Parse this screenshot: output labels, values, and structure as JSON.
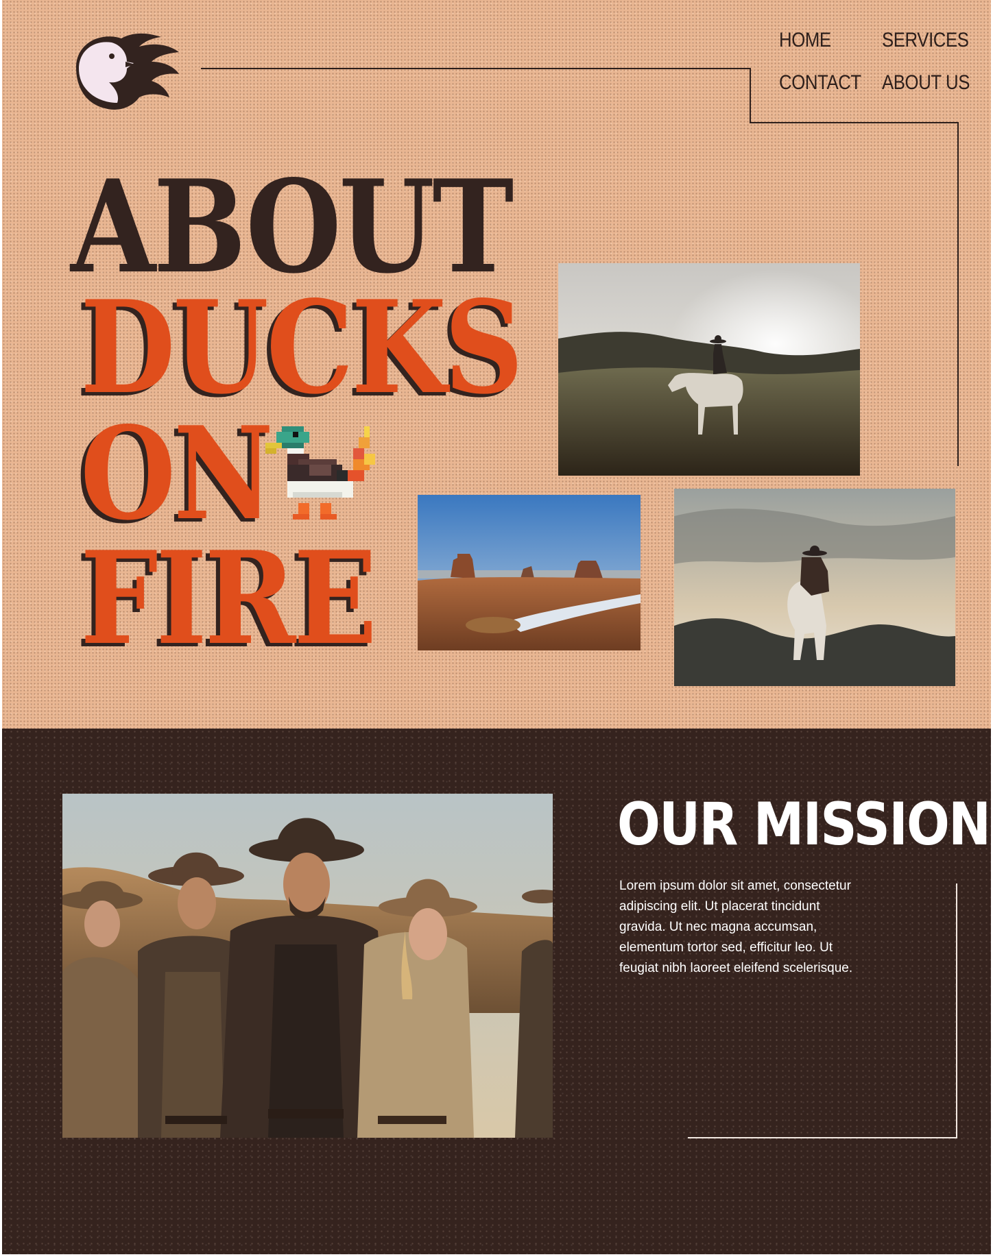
{
  "nav": {
    "home": "HOME",
    "services": "SERVICES",
    "contact": "CONTACT",
    "about": "ABOUT US"
  },
  "hero": {
    "line1": "ABOUT",
    "line2": "DUCKS",
    "line3": "ON",
    "line4": "FIRE"
  },
  "mission": {
    "title": "OUR MISSION",
    "body": "Lorem ipsum dolor sit amet, consectetur adipiscing elit. Ut placerat tincidunt gravida. Ut nec magna accumsan, elementum tortor sed, efficitur leo. Ut feugiat nibh laoreet eleifend scelerisque."
  },
  "colors": {
    "hero_bg": "#e9b692",
    "dark_brown": "#33231f",
    "fire_orange": "#e04e1c",
    "mission_bg": "#35231e"
  },
  "icons": {
    "logo": "flaming-duck-logo-icon",
    "pixel_duck": "pixel-duck-on-fire-icon"
  }
}
